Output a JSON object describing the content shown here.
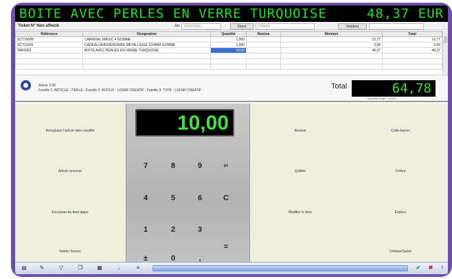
{
  "banner": {
    "product": "BOITE AVEC PERLES EN VERRE TURQUOISE",
    "price": "48,37 EUR"
  },
  "ticket": {
    "label": "Ticket N° Non affecté",
    "au_label": "Au",
    "au_value": "10/05/2009",
    "client_label": "Client",
    "client_value": "DIVERS",
    "vendeur_label": "Vendeur",
    "vendeur_value": ""
  },
  "table": {
    "headers": [
      "Référence",
      "Désignation",
      "Quantité",
      "Remise",
      "Montant",
      "Total"
    ],
    "rows": [
      {
        "ref": "SCT10008",
        "designation": "CARNIVAL MAGIC 4 GOMME",
        "qte": "1,000",
        "remise": "",
        "montant": "12,77",
        "total": "12,77"
      },
      {
        "ref": "SCT10041",
        "designation": "CADEAU ANNIVERSAIRE METALLIQUE 10/4MM GOMME",
        "qte": "1,000",
        "remise": "",
        "montant": "3,58",
        "total": "3,58"
      },
      {
        "ref": "TAK0002",
        "designation": "BOITE AVEC PERLES EN VERRE TURQUOISE",
        "qte": "10,00",
        "remise": "",
        "montant": "48,37",
        "total": "48,37"
      }
    ]
  },
  "summary": {
    "line1": "Article                          3,00",
    "line2": "Famille 1: ARTICLE - PERLE - Famille 2: BIJOUX - LOISIR CREATIF - Famille 3: TYPE - LOISIR CREATIF",
    "total_label": "Total",
    "total_value": "64,78",
    "sub": "Quantité totale : 12,000"
  },
  "actions_left": [
    "Remplacer l'article dans modifié",
    "Article connexe",
    "Encaisser du tiers lappe",
    "Valider facture"
  ],
  "actions_right_a": [
    "Remise",
    "Quittée",
    "Modifier le tiers",
    ""
  ],
  "actions_right_b": [
    "Code-barres",
    "Critère",
    "Espèce",
    "Chèque/Saisie"
  ],
  "keypad": {
    "display": "10,00",
    "keys": [
      "7",
      "8",
      "9",
      "⇦",
      "4",
      "5",
      "6",
      "C",
      "1",
      "2",
      "3",
      "±",
      "0",
      ",",
      "="
    ]
  },
  "toolbar": {
    "icons": [
      "print-icon",
      "edit-icon",
      "filter-icon",
      "copy-icon",
      "grid-icon",
      "down-icon",
      "list-icon"
    ]
  },
  "colors": {
    "frame": "#6b4fa8",
    "led": "#1fe01f",
    "selection": "#3a6fd0"
  }
}
